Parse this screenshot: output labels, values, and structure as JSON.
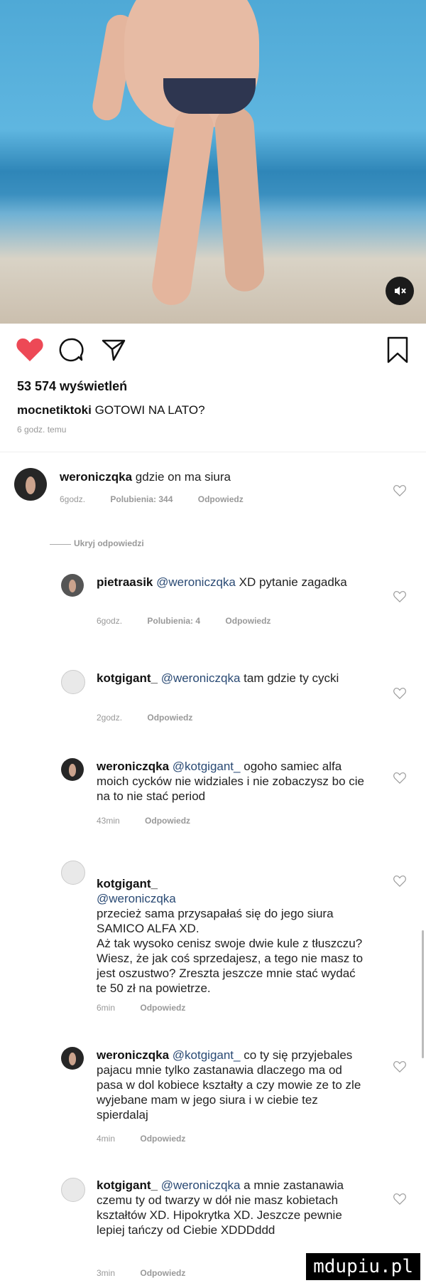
{
  "post": {
    "views": "53 574 wyświetleń",
    "author": "mocnetiktoki",
    "caption": "GOTOWI NA LATO?",
    "time": "6 godz. temu"
  },
  "hidden_replies": "Ukryj odpowiedzi",
  "comments": [
    {
      "user": "weroniczqka",
      "mention": "",
      "text": "gdzie on ma siura",
      "time": "6godz.",
      "likes": "Polubienia: 344",
      "reply": "Odpowiedz"
    },
    {
      "user": "pietraasik",
      "mention": "@weroniczqka",
      "text": "XD pytanie zagadka",
      "time": "6godz.",
      "likes": "Polubienia: 4",
      "reply": "Odpowiedz"
    },
    {
      "user": "kotgigant_",
      "mention": "@weroniczqka",
      "text": "tam gdzie ty cycki",
      "time": "2godz.",
      "likes": "",
      "reply": "Odpowiedz"
    },
    {
      "user": "weroniczqka",
      "mention": "@kotgigant_",
      "text": "ogoho samiec alfa moich cycków nie widziales i nie zobaczysz bo cie na to nie stać period",
      "time": "43min",
      "likes": "",
      "reply": "Odpowiedz"
    },
    {
      "user": "kotgigant_",
      "mention": "@weroniczqka",
      "text": "przecież sama przysapałaś się do jego siura SAMICO ALFA XD.\nAż tak wysoko cenisz swoje dwie kule z tłuszczu? Wiesz, że jak coś sprzedajesz, a tego nie masz to jest oszustwo? Zreszta jeszcze mnie stać wydać te 50 zł na powietrze.",
      "time": "6min",
      "likes": "",
      "reply": "Odpowiedz"
    },
    {
      "user": "weroniczqka",
      "mention": "@kotgigant_",
      "text": "co ty się przyjebales pajacu mnie tylko zastanawia dlaczego ma od pasa w dol kobiece kształty a czy mowie ze to zle wyjebane mam w jego siura i w ciebie tez spierdalaj",
      "time": "4min",
      "likes": "",
      "reply": "Odpowiedz"
    },
    {
      "user": "kotgigant_",
      "mention": "@weroniczqka",
      "text": "a mnie zastanawia czemu ty od twarzy w dół nie masz kobietach kształtów XD. Hipokrytka XD. Jeszcze pewnie lepiej tańczy od Ciebie XDDDddd",
      "time": "3min",
      "likes": "",
      "reply": "Odpowiedz"
    }
  ],
  "watermark": "mdupiu.pl",
  "colors": {
    "heart": "#ed4956",
    "mention": "#2a4a74",
    "meta": "#999999"
  },
  "icons": [
    "heart-icon",
    "comment-icon",
    "share-icon",
    "bookmark-icon",
    "mute-icon"
  ]
}
